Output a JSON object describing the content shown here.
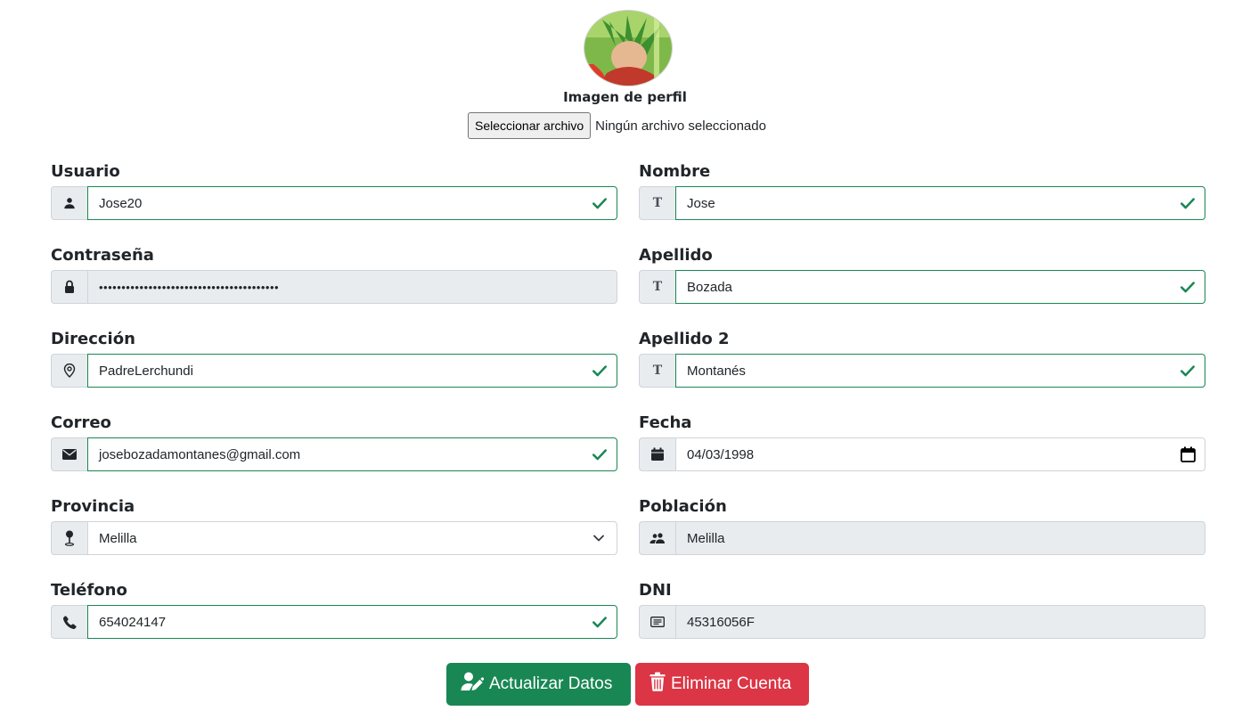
{
  "profile": {
    "caption": "Imagen de perfil",
    "file_button": "Seleccionar archivo",
    "file_status": "Ningún archivo seleccionado"
  },
  "fields": {
    "usuario": {
      "label": "Usuario",
      "value": "Jose20"
    },
    "nombre": {
      "label": "Nombre",
      "value": "Jose"
    },
    "contrasena": {
      "label": "Contraseña",
      "value": "••••••••••••••••••••••••••••••••••••••••"
    },
    "apellido": {
      "label": "Apellido",
      "value": "Bozada"
    },
    "direccion": {
      "label": "Dirección",
      "value": "PadreLerchundi"
    },
    "apellido2": {
      "label": "Apellido 2",
      "value": "Montanés"
    },
    "correo": {
      "label": "Correo",
      "value": "josebozadamontanes@gmail.com"
    },
    "fecha": {
      "label": "Fecha",
      "value": "04/03/1998"
    },
    "provincia": {
      "label": "Provincia",
      "value": "Melilla"
    },
    "poblacion": {
      "label": "Población",
      "value": "Melilla"
    },
    "telefono": {
      "label": "Teléfono",
      "value": "654024147"
    },
    "dni": {
      "label": "DNI",
      "value": "45316056F"
    }
  },
  "addon_letter": "T",
  "actions": {
    "update_label": "Actualizar Datos",
    "delete_label": "Eliminar Cuenta"
  },
  "icons": {
    "usuario": "person-icon",
    "contrasena": "lock-icon",
    "direccion": "map-pin-icon",
    "correo": "envelope-icon",
    "provincia": "pushpin-icon",
    "telefono": "phone-icon",
    "fecha": "calendar-icon",
    "poblacion": "people-icon",
    "dni": "id-card-icon",
    "valid": "check-icon",
    "select": "chevron-down-icon",
    "update": "user-edit-icon",
    "delete": "trash-icon"
  },
  "colors": {
    "success": "#198754",
    "danger": "#dc3545",
    "addon_bg": "#e9ecef",
    "border": "#ced4da"
  }
}
